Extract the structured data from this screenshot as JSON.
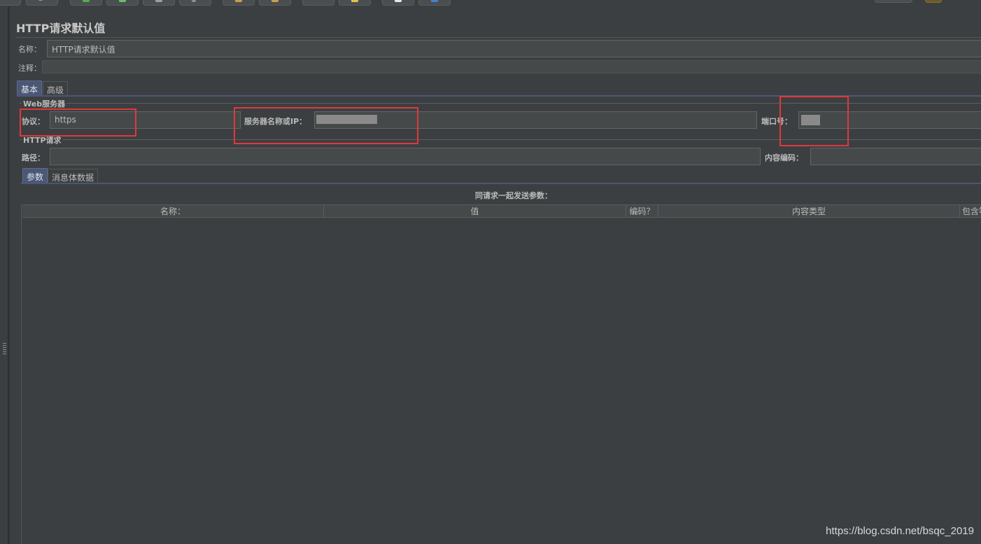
{
  "page_title": "HTTP请求默认值",
  "name_field": {
    "label": "名称：",
    "value": "HTTP请求默认值"
  },
  "comment_field": {
    "label": "注释：",
    "value": ""
  },
  "tabs": [
    {
      "label": "基本",
      "active": true
    },
    {
      "label": "高级",
      "active": false
    }
  ],
  "web_server": {
    "legend": "Web服务器",
    "protocol": {
      "label": "协议：",
      "value": "https"
    },
    "server": {
      "label": "服务器名称或IP：",
      "value": ""
    },
    "port": {
      "label": "端口号：",
      "value": ""
    }
  },
  "http_request": {
    "legend": "HTTP请求",
    "path": {
      "label": "路径：",
      "value": ""
    },
    "encoding": {
      "label": "内容编码：",
      "value": ""
    }
  },
  "sub_tabs": [
    {
      "label": "参数",
      "active": true
    },
    {
      "label": "消息体数据",
      "active": false
    }
  ],
  "params_table": {
    "caption": "同请求一起发送参数：",
    "columns": [
      "名称：",
      "值",
      "编码？",
      "内容类型",
      "包含等于？"
    ],
    "rows": []
  },
  "watermark": "https://blog.csdn.net/bsqc_2019",
  "colors": {
    "background": "#3c3f41",
    "tab_active": "#4a5777",
    "highlight_box": "#e0383b"
  }
}
